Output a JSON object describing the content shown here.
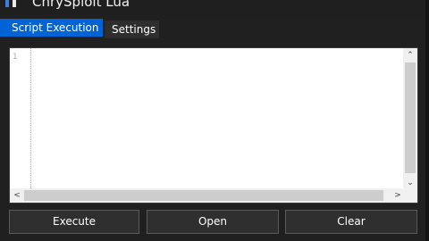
{
  "window": {
    "title": "ChrySploit Lua"
  },
  "tabs": [
    {
      "label": "Script Execution",
      "active": true
    },
    {
      "label": "Settings",
      "active": false
    }
  ],
  "editor": {
    "line_numbers": [
      "1"
    ],
    "content": ""
  },
  "scrollbars": {
    "up_glyph": "⌃",
    "down_glyph": "⌄",
    "left_glyph": "<",
    "right_glyph": ">"
  },
  "actions": {
    "execute_label": "Execute",
    "open_label": "Open",
    "clear_label": "Clear"
  },
  "colors": {
    "accent": "#0063d6",
    "background": "#202020",
    "button": "#2f2f2f"
  },
  "icons": {
    "app": "app-logo-icon"
  }
}
